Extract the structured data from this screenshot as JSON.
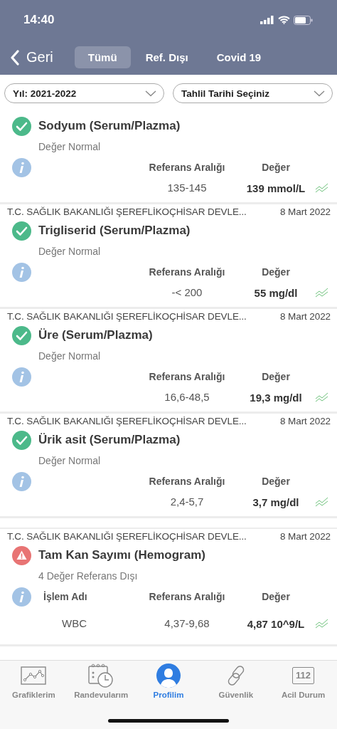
{
  "status_bar": {
    "time": "14:40"
  },
  "nav": {
    "back": "Geri",
    "tabs": [
      {
        "label": "Tümü",
        "selected": true
      },
      {
        "label": "Ref. Dışı",
        "selected": false
      },
      {
        "label": "Covid 19",
        "selected": false
      }
    ]
  },
  "filters": [
    {
      "value": "Yıl: 2021-2022"
    },
    {
      "value": "Tahlil Tarihi Seçiniz"
    }
  ],
  "results": [
    {
      "kind": "normal",
      "title": "Sodyum (Serum/Plazma)",
      "summary": "Değer Normal",
      "columns": [
        "Referans Aralığı",
        "Değer"
      ],
      "rows": [
        {
          "range": "135-145",
          "value": "139 mmol/L"
        }
      ]
    },
    {
      "hospital": "T.C. SAĞLIK BAKANLIĞI ŞEREFLİKOÇHİSAR DEVLE...",
      "date": "8 Mart 2022",
      "kind": "normal",
      "title": "Trigliserid (Serum/Plazma)",
      "summary": "Değer Normal",
      "columns": [
        "Referans Aralığı",
        "Değer"
      ],
      "rows": [
        {
          "range": "-< 200",
          "value": "55 mg/dl"
        }
      ]
    },
    {
      "hospital": "T.C. SAĞLIK BAKANLIĞI ŞEREFLİKOÇHİSAR DEVLE...",
      "date": "8 Mart 2022",
      "kind": "normal",
      "title": "Üre (Serum/Plazma)",
      "summary": "Değer Normal",
      "columns": [
        "Referans Aralığı",
        "Değer"
      ],
      "rows": [
        {
          "range": "16,6-48,5",
          "value": "19,3 mg/dl"
        }
      ]
    },
    {
      "hospital": "T.C. SAĞLIK BAKANLIĞI ŞEREFLİKOÇHİSAR DEVLE...",
      "date": "8 Mart 2022",
      "kind": "normal",
      "title": "Ürik asit (Serum/Plazma)",
      "summary": "Değer Normal",
      "columns": [
        "Referans Aralığı",
        "Değer"
      ],
      "rows": [
        {
          "range": "2,4-5,7",
          "value": "3,7 mg/dl"
        }
      ]
    },
    {
      "hospital": "T.C. SAĞLIK BAKANLIĞI ŞEREFLİKOÇHİSAR DEVLE...",
      "date": "8 Mart 2022",
      "kind": "abnormal",
      "title": "Tam Kan Sayımı (Hemogram)",
      "summary": "4 Değer Referans Dışı",
      "name_column": "İşlem Adı",
      "columns": [
        "Referans Aralığı",
        "Değer"
      ],
      "rows": [
        {
          "name": "WBC",
          "range": "4,37-9,68",
          "value": "4,87 10^9/L"
        }
      ]
    }
  ],
  "tab_bar": [
    {
      "label": "Grafiklerim",
      "selected": false
    },
    {
      "label": "Randevularım",
      "selected": false
    },
    {
      "label": "Profilim",
      "selected": true
    },
    {
      "label": "Güvenlik",
      "selected": false
    },
    {
      "label": "Acil Durum",
      "selected": false,
      "badge": "112"
    }
  ]
}
